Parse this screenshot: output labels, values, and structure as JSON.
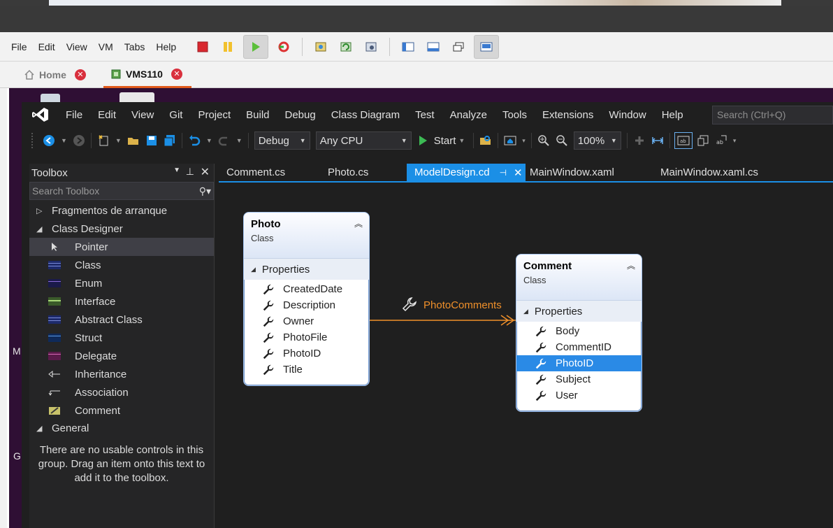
{
  "vmware": {
    "menus": [
      "File",
      "Edit",
      "View",
      "VM",
      "Tabs",
      "Help"
    ],
    "tabs": [
      {
        "label": "Home"
      },
      {
        "label": "VMS110"
      }
    ]
  },
  "desktop": {
    "side_letters": [
      "M",
      "G"
    ]
  },
  "vs": {
    "menus": [
      "File",
      "Edit",
      "View",
      "Git",
      "Project",
      "Build",
      "Debug",
      "Class Diagram",
      "Test",
      "Analyze",
      "Tools",
      "Extensions",
      "Window",
      "Help"
    ],
    "search_placeholder": "Search (Ctrl+Q)",
    "toolbar": {
      "config": "Debug",
      "platform": "Any CPU",
      "start_label": "Start",
      "zoom": "100%"
    },
    "toolbox": {
      "title": "Toolbox",
      "search_placeholder": "Search Toolbox",
      "groups": [
        {
          "label": "Fragmentos de arranque",
          "expanded": false
        },
        {
          "label": "Class Designer",
          "expanded": true
        }
      ],
      "items": [
        {
          "label": "Pointer",
          "icon": "pointer-icon"
        },
        {
          "label": "Class",
          "icon": "class-icon"
        },
        {
          "label": "Enum",
          "icon": "enum-icon"
        },
        {
          "label": "Interface",
          "icon": "interface-icon"
        },
        {
          "label": "Abstract Class",
          "icon": "abstract-class-icon"
        },
        {
          "label": "Struct",
          "icon": "struct-icon"
        },
        {
          "label": "Delegate",
          "icon": "delegate-icon"
        },
        {
          "label": "Inheritance",
          "icon": "inheritance-icon"
        },
        {
          "label": "Association",
          "icon": "association-icon"
        },
        {
          "label": "Comment",
          "icon": "comment-icon"
        }
      ],
      "general_group": "General",
      "empty_text": "There are no usable controls in this group. Drag an item onto this text to add it to the toolbox."
    },
    "doc_tabs": [
      "Comment.cs",
      "Photo.cs",
      "ModelDesign.cd",
      "MainWindow.xaml",
      "MainWindow.xaml.cs"
    ],
    "active_tab": "ModelDesign.cd",
    "diagram": {
      "photo": {
        "name": "Photo",
        "kind": "Class",
        "section": "Properties",
        "properties": [
          "CreatedDate",
          "Description",
          "Owner",
          "PhotoFile",
          "PhotoID",
          "Title"
        ]
      },
      "comment": {
        "name": "Comment",
        "kind": "Class",
        "section": "Properties",
        "properties": [
          "Body",
          "CommentID",
          "PhotoID",
          "Subject",
          "User"
        ],
        "selected_property": "PhotoID"
      },
      "association_label": "PhotoComments",
      "colors": {
        "association": "#f0902a",
        "selection": "#2a8ae6",
        "accent": "#1b8fe6"
      }
    }
  }
}
